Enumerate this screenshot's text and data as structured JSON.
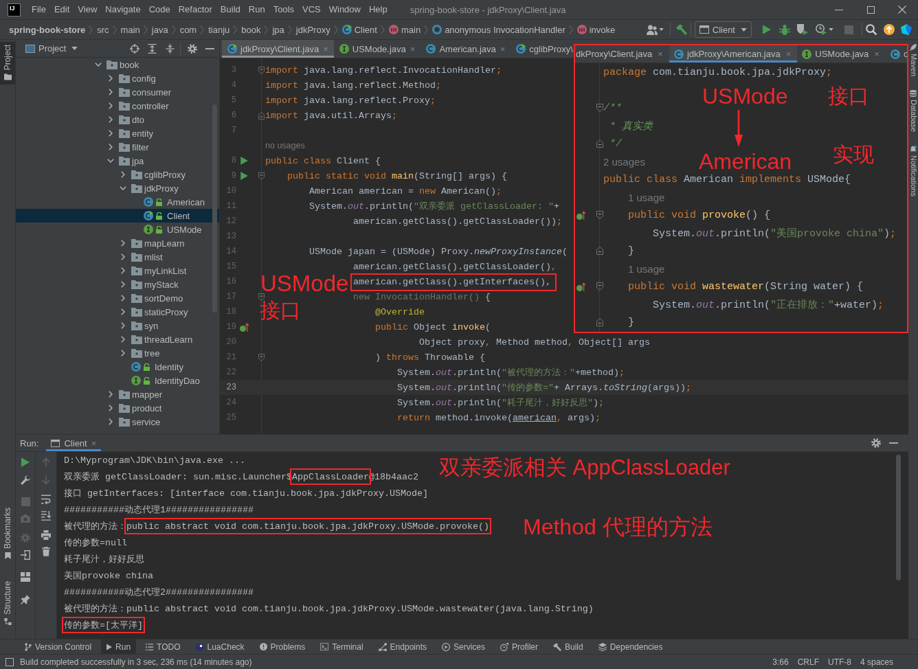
{
  "window": {
    "logo": "IJ",
    "title": "spring-book-store - jdkProxy\\Client.java"
  },
  "menu": [
    "File",
    "Edit",
    "View",
    "Navigate",
    "Code",
    "Refactor",
    "Build",
    "Run",
    "Tools",
    "VCS",
    "Window",
    "Help"
  ],
  "breadcrumb": [
    {
      "label": "spring-book-store",
      "kind": "project"
    },
    {
      "label": "src",
      "kind": "folder"
    },
    {
      "label": "main",
      "kind": "folder"
    },
    {
      "label": "java",
      "kind": "folder"
    },
    {
      "label": "com",
      "kind": "folder"
    },
    {
      "label": "tianju",
      "kind": "folder"
    },
    {
      "label": "book",
      "kind": "folder"
    },
    {
      "label": "jpa",
      "kind": "folder"
    },
    {
      "label": "jdkProxy",
      "kind": "folder"
    },
    {
      "label": "Client",
      "kind": "runnable_class"
    },
    {
      "label": "main",
      "kind": "method"
    },
    {
      "label": "anonymous InvocationHandler",
      "kind": "anonymous_class"
    },
    {
      "label": "invoke",
      "kind": "method"
    }
  ],
  "toolbar": {
    "run_configuration": "Client"
  },
  "left_strip": {
    "top": [
      {
        "label": "Project",
        "selected": true
      }
    ],
    "bottom": [
      {
        "label": "Bookmarks",
        "selected": false
      },
      {
        "label": "Structure",
        "selected": false
      }
    ]
  },
  "right_strip": [
    {
      "label": "Maven"
    },
    {
      "label": "Database"
    },
    {
      "label": "Notifications"
    }
  ],
  "project": {
    "title": "Project",
    "tree": [
      {
        "label": "book",
        "kind": "package",
        "expanded": true,
        "selected": false,
        "children": [
          {
            "label": "config",
            "kind": "package",
            "expanded": false,
            "selected": false
          },
          {
            "label": "consumer",
            "kind": "package",
            "expanded": false,
            "selected": false
          },
          {
            "label": "controller",
            "kind": "package",
            "expanded": false,
            "selected": false
          },
          {
            "label": "dto",
            "kind": "package",
            "expanded": false,
            "selected": false
          },
          {
            "label": "entity",
            "kind": "package",
            "expanded": false,
            "selected": false
          },
          {
            "label": "filter",
            "kind": "package",
            "expanded": false,
            "selected": false
          },
          {
            "label": "jpa",
            "kind": "package",
            "expanded": true,
            "selected": false,
            "children": [
              {
                "label": "cglibProxy",
                "kind": "package",
                "expanded": false,
                "selected": false
              },
              {
                "label": "jdkProxy",
                "kind": "package",
                "expanded": true,
                "selected": false,
                "children": [
                  {
                    "label": "American",
                    "kind": "class",
                    "selected": false
                  },
                  {
                    "label": "Client",
                    "kind": "runnable_class",
                    "selected": true
                  },
                  {
                    "label": "USMode",
                    "kind": "interface",
                    "selected": false
                  }
                ]
              },
              {
                "label": "mapLearn",
                "kind": "package",
                "expanded": false,
                "selected": false
              },
              {
                "label": "mlist",
                "kind": "package",
                "expanded": false,
                "selected": false
              },
              {
                "label": "myLinkList",
                "kind": "package",
                "expanded": false,
                "selected": false
              },
              {
                "label": "myStack",
                "kind": "package",
                "expanded": false,
                "selected": false
              },
              {
                "label": "sortDemo",
                "kind": "package",
                "expanded": false,
                "selected": false
              },
              {
                "label": "staticProxy",
                "kind": "package",
                "expanded": false,
                "selected": false
              },
              {
                "label": "syn",
                "kind": "package",
                "expanded": false,
                "selected": false
              },
              {
                "label": "threadLearn",
                "kind": "package",
                "expanded": false,
                "selected": false
              },
              {
                "label": "tree",
                "kind": "package",
                "expanded": false,
                "selected": false
              },
              {
                "label": "Identity",
                "kind": "class",
                "selected": false
              },
              {
                "label": "IdentityDao",
                "kind": "interface",
                "selected": false
              }
            ]
          },
          {
            "label": "mapper",
            "kind": "package",
            "expanded": false,
            "selected": false
          },
          {
            "label": "product",
            "kind": "package",
            "expanded": false,
            "selected": false
          },
          {
            "label": "service",
            "kind": "package",
            "expanded": false,
            "selected": false
          }
        ]
      }
    ]
  },
  "editor": {
    "tabs": [
      {
        "label": "jdkProxy\\Client.java",
        "kind": "runnable_class",
        "close": "×",
        "selected": true
      },
      {
        "label": "USMode.java",
        "kind": "interface",
        "close": "×",
        "selected": false
      },
      {
        "label": "American.java",
        "kind": "class",
        "close": "×",
        "selected": false
      },
      {
        "label": "cglibProxy\\",
        "kind": "runnable_class",
        "selected": false
      }
    ],
    "lines": [
      {
        "kind": "code",
        "num": "3",
        "fold_start": true,
        "current": false,
        "tokens": [
          {
            "text": "import",
            "kind": "keyword"
          },
          {
            "text": " java.lang.reflect.InvocationHandler",
            "kind": "plain"
          },
          {
            "text": ";",
            "kind": "separator"
          }
        ]
      },
      {
        "kind": "code",
        "num": "4",
        "current": false,
        "tokens": [
          {
            "text": "import",
            "kind": "keyword"
          },
          {
            "text": " java.lang.reflect.Method",
            "kind": "plain"
          },
          {
            "text": ";",
            "kind": "separator"
          }
        ]
      },
      {
        "kind": "code",
        "num": "5",
        "current": false,
        "tokens": [
          {
            "text": "import",
            "kind": "keyword"
          },
          {
            "text": " java.lang.reflect.Proxy",
            "kind": "plain"
          },
          {
            "text": ";",
            "kind": "separator"
          }
        ]
      },
      {
        "kind": "code",
        "num": "6",
        "fold_end": true,
        "current": false,
        "tokens": [
          {
            "text": "import",
            "kind": "keyword"
          },
          {
            "text": " java.util.Arrays",
            "kind": "plain"
          },
          {
            "text": ";",
            "kind": "separator"
          }
        ]
      },
      {
        "kind": "code",
        "num": "7",
        "current": false
      },
      {
        "kind": "hint",
        "text": "no usages"
      },
      {
        "kind": "code",
        "num": "8",
        "run_marker": true,
        "current": false,
        "tokens": [
          {
            "text": "public class ",
            "kind": "keyword"
          },
          {
            "text": "Client {",
            "kind": "plain"
          }
        ],
        "children": [
          {
            "kind": "code",
            "num": "9",
            "run_marker": true,
            "fold_start": true,
            "current": false,
            "tokens": [
              {
                "text": "public static void ",
                "kind": "keyword"
              },
              {
                "text": "main",
                "kind": "declaration"
              },
              {
                "text": "(String[] args) {",
                "kind": "plain"
              }
            ],
            "children": [
              {
                "kind": "code",
                "num": "10",
                "current": false,
                "tokens": [
                  {
                    "text": "American american = ",
                    "kind": "plain"
                  },
                  {
                    "text": "new",
                    "kind": "keyword"
                  },
                  {
                    "text": " American()",
                    "kind": "plain"
                  },
                  {
                    "text": ";",
                    "kind": "separator"
                  }
                ]
              },
              {
                "kind": "code",
                "num": "11",
                "current": false,
                "tokens": [
                  {
                    "text": "System.",
                    "kind": "plain"
                  },
                  {
                    "text": "out",
                    "kind": "static_field"
                  },
                  {
                    "text": ".println(",
                    "kind": "plain"
                  },
                  {
                    "text": "\"双亲委派 getClassLoader: \"",
                    "kind": "string"
                  },
                  {
                    "text": "+",
                    "kind": "plain"
                  }
                ],
                "children": [
                  {
                    "kind": "continuation",
                    "num": "12",
                    "current": false,
                    "tokens": [
                      {
                        "text": "american.getClass().getClassLoader())",
                        "kind": "plain"
                      },
                      {
                        "text": ";",
                        "kind": "separator"
                      }
                    ]
                  }
                ]
              },
              {
                "kind": "code",
                "num": "13",
                "current": false
              },
              {
                "kind": "code",
                "num": "14",
                "current": false,
                "tokens": [
                  {
                    "text": "USMode japan = (USMode) Proxy.",
                    "kind": "plain"
                  },
                  {
                    "text": "newProxyInstance",
                    "kind": "italic"
                  },
                  {
                    "text": "(",
                    "kind": "plain"
                  }
                ],
                "children": [
                  {
                    "kind": "continuation",
                    "num": "15",
                    "current": false,
                    "tokens": [
                      {
                        "text": "american.getClass().getClassLoader()",
                        "kind": "plain"
                      },
                      {
                        "text": ",",
                        "kind": "separator"
                      }
                    ]
                  },
                  {
                    "kind": "continuation",
                    "num": "16",
                    "current": false,
                    "tokens": [
                      {
                        "text": "american.getClass().getInterfaces(),",
                        "kind": "plain",
                        "boxed": true
                      }
                    ]
                  },
                  {
                    "kind": "continuation",
                    "num": "17",
                    "fold_start": true,
                    "current": false,
                    "tokens": [
                      {
                        "text": "new InvocationHandler()",
                        "kind": "unused"
                      },
                      {
                        "text": " {",
                        "kind": "plain"
                      }
                    ],
                    "children": [
                      {
                        "kind": "code",
                        "num": "18",
                        "current": false,
                        "tokens": [
                          {
                            "text": "@Override",
                            "kind": "annotation"
                          }
                        ]
                      },
                      {
                        "kind": "code",
                        "num": "19",
                        "implements_marker": true,
                        "current": false,
                        "tokens": [
                          {
                            "text": "public ",
                            "kind": "keyword"
                          },
                          {
                            "text": "Object ",
                            "kind": "plain"
                          },
                          {
                            "text": "invoke",
                            "kind": "declaration"
                          },
                          {
                            "text": "(",
                            "kind": "plain"
                          }
                        ],
                        "children": [
                          {
                            "kind": "continuation",
                            "num": "20",
                            "current": false,
                            "tokens": [
                              {
                                "text": "Object proxy",
                                "kind": "plain"
                              },
                              {
                                "text": ",",
                                "kind": "separator"
                              },
                              {
                                "text": " Method method",
                                "kind": "plain"
                              },
                              {
                                "text": ",",
                                "kind": "separator"
                              },
                              {
                                "text": " Object[] args",
                                "kind": "plain"
                              }
                            ]
                          }
                        ]
                      },
                      {
                        "kind": "code",
                        "num": "21",
                        "fold_start": true,
                        "current": false,
                        "tokens": [
                          {
                            "text": ") ",
                            "kind": "plain"
                          },
                          {
                            "text": "throws ",
                            "kind": "keyword"
                          },
                          {
                            "text": "Throwable {",
                            "kind": "plain"
                          }
                        ],
                        "children": [
                          {
                            "kind": "code",
                            "num": "22",
                            "current": false,
                            "tokens": [
                              {
                                "text": "System.",
                                "kind": "plain"
                              },
                              {
                                "text": "out",
                                "kind": "static_field"
                              },
                              {
                                "text": ".println(",
                                "kind": "plain"
                              },
                              {
                                "text": "\"被代理的方法：\"",
                                "kind": "string"
                              },
                              {
                                "text": "+method)",
                                "kind": "plain"
                              },
                              {
                                "text": ";",
                                "kind": "separator"
                              }
                            ]
                          },
                          {
                            "kind": "code",
                            "num": "23",
                            "current": true,
                            "tokens": [
                              {
                                "text": "System.",
                                "kind": "plain"
                              },
                              {
                                "text": "out",
                                "kind": "static_field"
                              },
                              {
                                "text": ".println(",
                                "kind": "plain"
                              },
                              {
                                "text": "\"传的参数=\"",
                                "kind": "string"
                              },
                              {
                                "text": "+ Arrays.",
                                "kind": "plain"
                              },
                              {
                                "text": "toString",
                                "kind": "italic"
                              },
                              {
                                "text": "(args))",
                                "kind": "plain"
                              },
                              {
                                "text": ";",
                                "kind": "separator"
                              }
                            ]
                          },
                          {
                            "kind": "code",
                            "num": "24",
                            "current": false,
                            "tokens": [
                              {
                                "text": "System.",
                                "kind": "plain"
                              },
                              {
                                "text": "out",
                                "kind": "static_field"
                              },
                              {
                                "text": ".println(",
                                "kind": "plain"
                              },
                              {
                                "text": "\"耗子尾汁，好好反思\"",
                                "kind": "string"
                              },
                              {
                                "text": ")",
                                "kind": "plain"
                              },
                              {
                                "text": ";",
                                "kind": "separator"
                              }
                            ]
                          },
                          {
                            "kind": "code",
                            "num": "25",
                            "current": false,
                            "tokens": [
                              {
                                "text": "return ",
                                "kind": "keyword"
                              },
                              {
                                "text": "method.invoke(",
                                "kind": "plain"
                              },
                              {
                                "text": "american",
                                "kind": "underlined"
                              },
                              {
                                "text": ",",
                                "kind": "separator"
                              },
                              {
                                "text": " args)",
                                "kind": "plain"
                              },
                              {
                                "text": ";",
                                "kind": "separator"
                              }
                            ]
                          }
                        ]
                      }
                    ]
                  }
                ]
              }
            ]
          }
        ]
      }
    ],
    "annotations": [
      {
        "text": "USMode"
      },
      {
        "text": "接口"
      }
    ]
  },
  "inset_editor": {
    "tabs": [
      {
        "label": "dkProxy\\Client.java",
        "close": "×",
        "selected": false
      },
      {
        "label": "jdkProxy\\American.java",
        "kind": "class",
        "close": "×",
        "selected": true
      },
      {
        "label": "USMode.java",
        "kind": "interface",
        "close": "×",
        "selected": false
      },
      {
        "label": "c",
        "kind": "class",
        "selected": false
      }
    ],
    "lines": [
      {
        "kind": "code",
        "tokens": [
          {
            "text": "package ",
            "kind": "keyword"
          },
          {
            "text": "com.tianju.book.jpa.jdkProxy",
            "kind": "plain"
          },
          {
            "text": ";",
            "kind": "separator"
          }
        ]
      },
      {
        "kind": "code"
      },
      {
        "kind": "code",
        "fold_start": true,
        "tokens": [
          {
            "text": "/**",
            "kind": "doc_comment"
          }
        ]
      },
      {
        "kind": "code",
        "tokens": [
          {
            "text": " * 真实类",
            "kind": "doc_comment"
          }
        ]
      },
      {
        "kind": "code",
        "fold_end": true,
        "tokens": [
          {
            "text": " */",
            "kind": "doc_comment"
          }
        ]
      },
      {
        "kind": "hint",
        "text": "2 usages"
      },
      {
        "kind": "code",
        "tokens": [
          {
            "text": "public class ",
            "kind": "keyword"
          },
          {
            "text": "American ",
            "kind": "plain"
          },
          {
            "text": "implements ",
            "kind": "keyword"
          },
          {
            "text": "USMode{",
            "kind": "plain"
          }
        ],
        "children": [
          {
            "kind": "hint",
            "text": "1 usage"
          },
          {
            "kind": "code",
            "implements_marker": true,
            "fold_start": true,
            "tokens": [
              {
                "text": "public void ",
                "kind": "keyword"
              },
              {
                "text": "provoke",
                "kind": "declaration"
              },
              {
                "text": "() {",
                "kind": "plain"
              }
            ],
            "children": [
              {
                "kind": "code",
                "tokens": [
                  {
                    "text": "System.",
                    "kind": "plain"
                  },
                  {
                    "text": "out",
                    "kind": "static_field"
                  },
                  {
                    "text": ".println(",
                    "kind": "plain"
                  },
                  {
                    "text": "\"美国provoke china\"",
                    "kind": "string"
                  },
                  {
                    "text": ")",
                    "kind": "plain"
                  },
                  {
                    "text": ";",
                    "kind": "separator"
                  }
                ]
              }
            ]
          },
          {
            "kind": "code",
            "fold_end": true,
            "tokens": [
              {
                "text": "}",
                "kind": "plain"
              }
            ]
          },
          {
            "kind": "hint",
            "text": "1 usage"
          },
          {
            "kind": "code",
            "implements_marker": true,
            "fold_start": true,
            "tokens": [
              {
                "text": "public void ",
                "kind": "keyword"
              },
              {
                "text": "wastewater",
                "kind": "declaration"
              },
              {
                "text": "(String water) {",
                "kind": "plain"
              }
            ],
            "children": [
              {
                "kind": "code",
                "tokens": [
                  {
                    "text": "System.",
                    "kind": "plain"
                  },
                  {
                    "text": "out",
                    "kind": "static_field"
                  },
                  {
                    "text": ".println(",
                    "kind": "plain"
                  },
                  {
                    "text": "\"正在排放：\"",
                    "kind": "string"
                  },
                  {
                    "text": "+water)",
                    "kind": "plain"
                  },
                  {
                    "text": ";",
                    "kind": "separator"
                  }
                ]
              }
            ]
          },
          {
            "kind": "code",
            "fold_end": true,
            "tokens": [
              {
                "text": "}",
                "kind": "plain"
              }
            ]
          }
        ]
      }
    ],
    "annotations": [
      {
        "text": "USMode"
      },
      {
        "text": "接口"
      },
      {
        "text": "American"
      },
      {
        "text": "实现"
      }
    ]
  },
  "run": {
    "label": "Run:",
    "tabs": [
      {
        "label": "Client",
        "close": "×",
        "selected": true
      }
    ],
    "console": [
      {
        "parts": [
          {
            "text": "D:\\Myprogram\\JDK\\bin\\java.exe ..."
          }
        ]
      },
      {
        "parts": [
          {
            "text": "双亲委派 getClassLoader: sun.misc.Launcher$"
          },
          {
            "text": "AppClassLoader",
            "boxed": true
          },
          {
            "text": "@18b4aac2"
          }
        ]
      },
      {
        "parts": [
          {
            "text": "接口 getInterfaces: [interface com.tianju.book.jpa.jdkProxy.USMode]"
          }
        ]
      },
      {
        "parts": [
          {
            "text": "###########动态代理1################"
          }
        ]
      },
      {
        "parts": [
          {
            "text": "被代理的方法："
          },
          {
            "text": "public abstract void com.tianju.book.jpa.jdkProxy.USMode.provoke()",
            "boxed": true
          }
        ]
      },
      {
        "parts": [
          {
            "text": "传的参数=null"
          }
        ]
      },
      {
        "parts": [
          {
            "text": "耗子尾汁，好好反思"
          }
        ]
      },
      {
        "parts": [
          {
            "text": "美国provoke china"
          }
        ]
      },
      {
        "parts": [
          {
            "text": "###########动态代理2################"
          }
        ]
      },
      {
        "parts": [
          {
            "text": "被代理的方法：public abstract void com.tianju.book.jpa.jdkProxy.USMode.wastewater(java.lang.String)"
          }
        ]
      },
      {
        "parts": [
          {
            "text": "传的参数=[太平洋]",
            "boxed": true
          }
        ]
      }
    ],
    "annotations": [
      {
        "text": "双亲委派相关 AppClassLoader"
      },
      {
        "text": "Method 代理的方法"
      }
    ]
  },
  "tool_windows": [
    {
      "label": "Version Control",
      "selected": false
    },
    {
      "label": "Run",
      "selected": true
    },
    {
      "label": "TODO",
      "selected": false
    },
    {
      "label": "LuaCheck",
      "selected": false
    },
    {
      "label": "Problems",
      "selected": false
    },
    {
      "label": "Terminal",
      "selected": false
    },
    {
      "label": "Endpoints",
      "selected": false
    },
    {
      "label": "Services",
      "selected": false
    },
    {
      "label": "Profiler",
      "selected": false
    },
    {
      "label": "Build",
      "selected": false
    },
    {
      "label": "Dependencies",
      "selected": false
    }
  ],
  "status_bar": {
    "message": "Build completed successfully in 3 sec, 236 ms (14 minutes ago)",
    "items": [
      "3:66",
      "CRLF",
      "UTF-8",
      "4 spaces"
    ]
  }
}
